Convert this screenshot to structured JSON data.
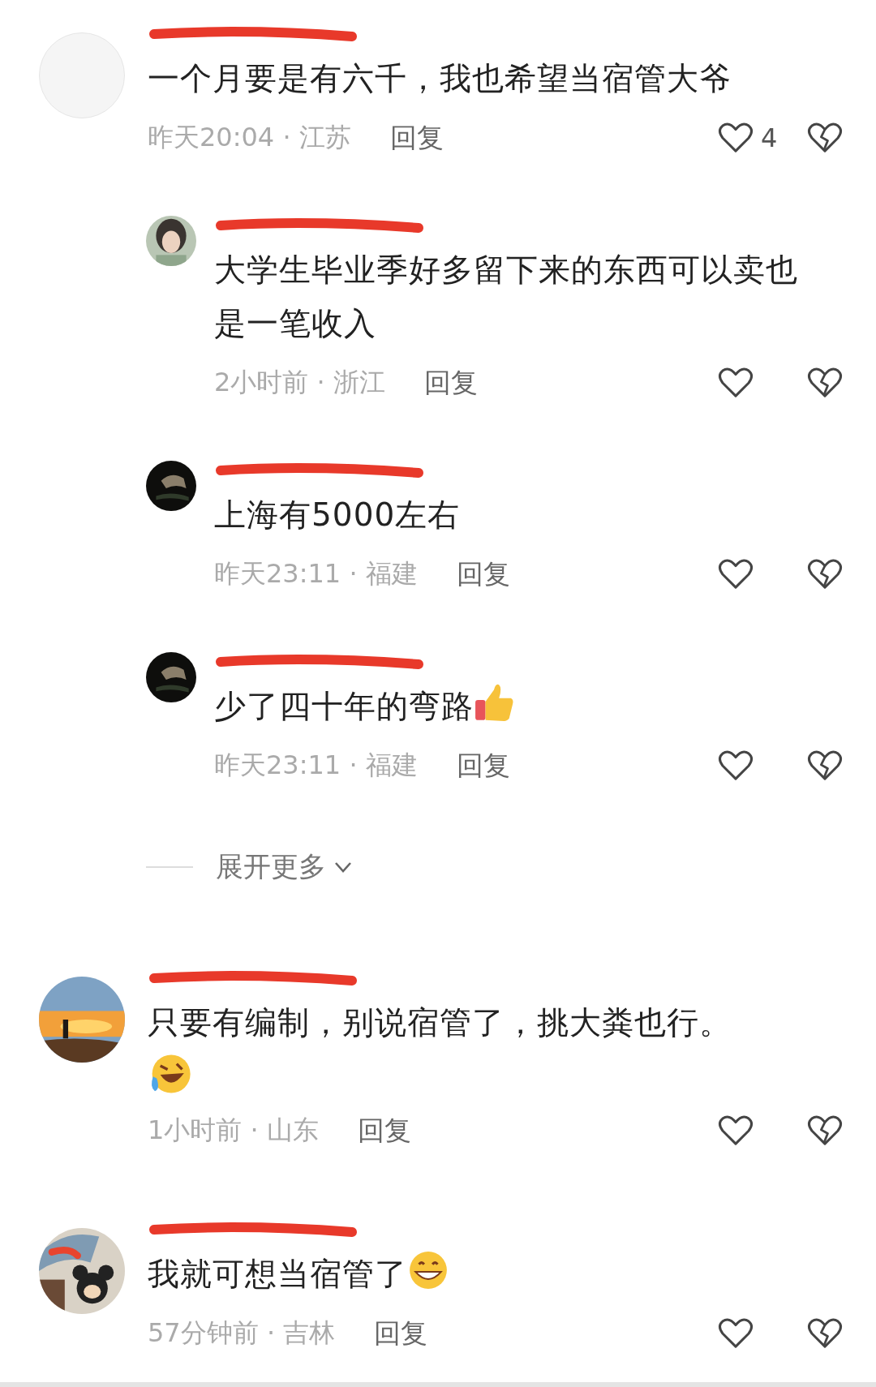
{
  "comments": [
    {
      "avatar": {
        "kind": "blank"
      },
      "name_redacted": true,
      "text": "一个月要是有六千，我也希望当宿管大爷",
      "meta": "昨天20:04 · 江苏",
      "reply": "回复",
      "likes": "4",
      "replies": [
        {
          "avatar": {
            "kind": "portrait"
          },
          "name_redacted": true,
          "text": "大学生毕业季好多留下来的东西可以卖也是一笔收入",
          "meta": "2小时前 · 浙江",
          "reply": "回复"
        },
        {
          "avatar": {
            "kind": "dark"
          },
          "name_redacted": true,
          "text": "上海有5000左右",
          "meta": "昨天23:11 · 福建",
          "reply": "回复"
        },
        {
          "avatar": {
            "kind": "dark"
          },
          "name_redacted": true,
          "text": "少了四十年的弯路",
          "emoji": {
            "kind": "thumbs-up"
          },
          "meta": "昨天23:11 · 福建",
          "reply": "回复"
        }
      ],
      "expand_more": "展开更多"
    },
    {
      "avatar": {
        "kind": "sunset"
      },
      "name_redacted": true,
      "text": "只要有编制，别说宿管了，挑大粪也行。",
      "emoji_line": {
        "kind": "laughing-crying"
      },
      "meta": "1小时前 · 山东",
      "reply": "回复"
    },
    {
      "avatar": {
        "kind": "toy"
      },
      "name_redacted": true,
      "text": "我就可想当宿管了",
      "emoji": {
        "kind": "grin"
      },
      "meta": "57分钟前 · 吉林",
      "reply": "回复"
    }
  ]
}
